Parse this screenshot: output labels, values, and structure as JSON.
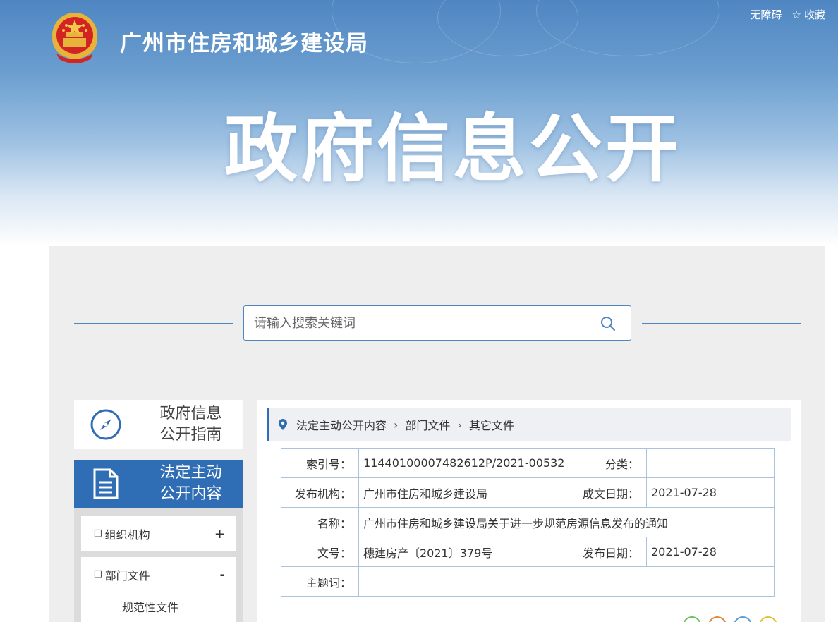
{
  "header": {
    "site_title": "广州市住房和城乡建设局",
    "links": {
      "accessibility": "无障碍",
      "favorite": "收藏"
    },
    "banner_title": "政府信息公开"
  },
  "search": {
    "placeholder": "请输入搜索关键词"
  },
  "sidebar": {
    "guide_label": "政府信息\n公开指南",
    "active_label": "法定主动\n公开内容",
    "items": [
      {
        "label": "组织机构",
        "toggle": "+"
      },
      {
        "label": "部门文件",
        "toggle": "-"
      }
    ],
    "sub_items": [
      {
        "label": "规范性文件"
      }
    ]
  },
  "breadcrumb": {
    "items": [
      "法定主动公开内容",
      "部门文件",
      "其它文件"
    ]
  },
  "meta": {
    "index_no_label": "索引号：",
    "index_no": "11440100007482612P/2021-00532",
    "category_label": "分类：",
    "category": "",
    "publisher_label": "发布机构：",
    "publisher": "广州市住房和城乡建设局",
    "created_label": "成文日期：",
    "created": "2021-07-28",
    "name_label": "名称：",
    "name": "广州市住房和城乡建设局关于进一步规范房源信息发布的通知",
    "doc_no_label": "文号：",
    "doc_no": "穗建房产〔2021〕379号",
    "published_label": "发布日期：",
    "published": "2021-07-28",
    "keywords_label": "主题词：",
    "keywords": ""
  },
  "colors": {
    "accent": "#2f6eb5",
    "panel": "#eeeeee",
    "border": "#a9c3dd"
  },
  "icons": {
    "emblem": "national-emblem-icon",
    "star": "star-icon",
    "search": "search-icon",
    "compass": "compass-icon",
    "document": "document-icon",
    "pin": "location-pin-icon"
  }
}
